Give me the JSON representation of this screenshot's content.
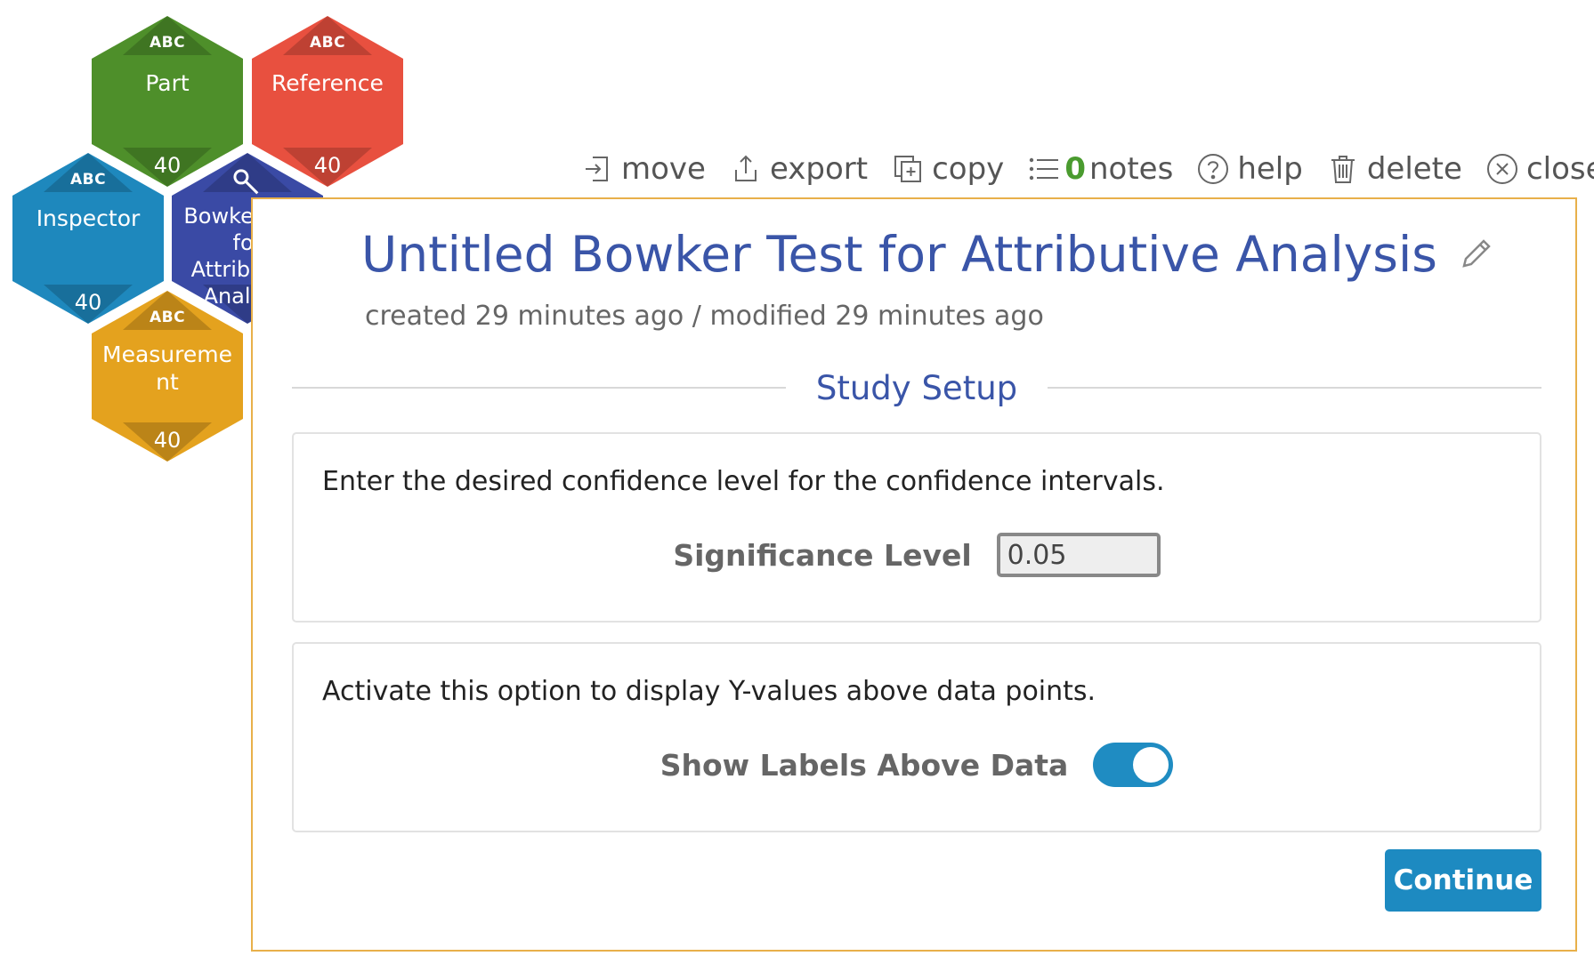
{
  "hexagons": {
    "part": {
      "abc": "ABC",
      "label": "Part",
      "count": "40",
      "color": "#4e8f2a"
    },
    "reference": {
      "abc": "ABC",
      "label": "Reference",
      "count": "40",
      "color": "#e8503f"
    },
    "inspector": {
      "abc": "ABC",
      "label": "Inspector",
      "count": "40",
      "color": "#1e88bd"
    },
    "bowker": {
      "label": "Bowker Test for Attributive Analysis",
      "icon": "wrench-icon",
      "color": "#3a4aa5"
    },
    "measurement": {
      "abc": "ABC",
      "label": "Measureme nt",
      "count": "40",
      "color": "#e4a21e"
    }
  },
  "toolbar": {
    "move": "move",
    "export": "export",
    "copy": "copy",
    "notes_count": "0",
    "notes": "notes",
    "help": "help",
    "delete": "delete",
    "close": "close"
  },
  "panel": {
    "title": "Untitled Bowker Test for Attributive Analysis",
    "meta": "created 29 minutes ago / modified 29 minutes ago",
    "section": "Study Setup"
  },
  "confidence": {
    "description": "Enter the desired confidence level for the confidence intervals.",
    "label": "Significance Level",
    "value": "0.05"
  },
  "labels_option": {
    "description": "Activate this option to display Y-values above data points.",
    "label": "Show Labels Above Data",
    "enabled": true
  },
  "continue_label": "Continue",
  "colors": {
    "accent": "#1d8ac1",
    "title": "#3a55a8",
    "border": "#e8b04a"
  }
}
